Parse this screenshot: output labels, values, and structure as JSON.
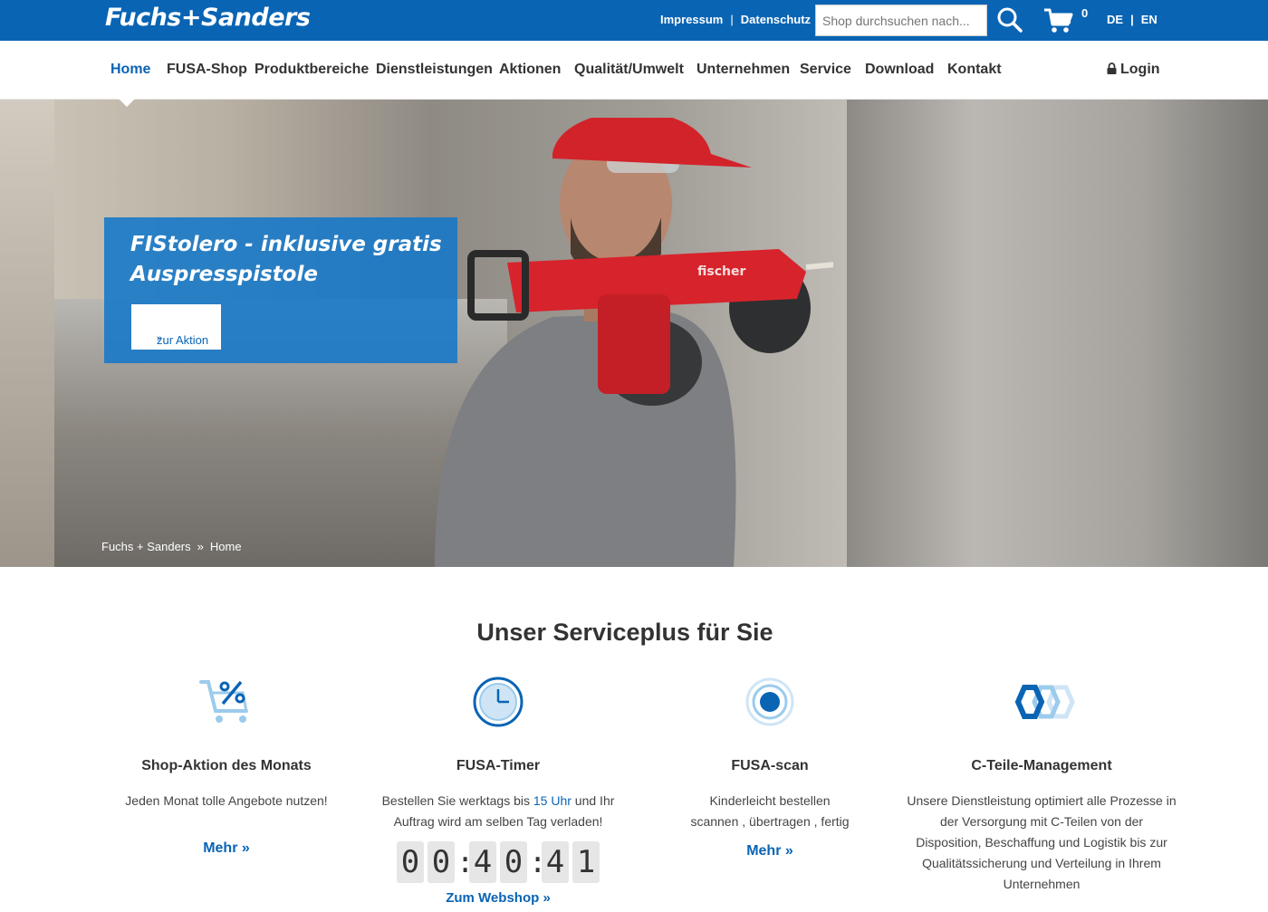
{
  "header": {
    "logo": "Fuchs+Sanders",
    "links": [
      "Impressum",
      "Datenschutz"
    ],
    "search_placeholder": "Shop durchsuchen nach...",
    "cart_count": "0",
    "languages": [
      "DE",
      "EN"
    ]
  },
  "nav": {
    "items": [
      "Home",
      "FUSA-Shop",
      "Produktbereiche",
      "Dienstleistungen",
      "Aktionen",
      "Qualität/Umwelt",
      "Unternehmen",
      "Service",
      "Download",
      "Kontakt"
    ],
    "active": "Home",
    "login_label": "Login"
  },
  "hero": {
    "title": "FIStolero - inklusive gratis Auspresspistole",
    "button_label": "zur Aktion",
    "button_arrow": "»",
    "breadcrumb": [
      "Fuchs + Sanders",
      "Home"
    ],
    "tool_brand": "fischer"
  },
  "services": {
    "title": "Unser Serviceplus für Sie",
    "items": [
      {
        "title": "Shop-Aktion des Monats",
        "text": "Jeden Monat tolle Angebote nutzen!",
        "link": "Mehr  »",
        "icon": "cart-percent-icon"
      },
      {
        "title": "FUSA-Timer",
        "text_pre": "Bestellen Sie werktags bis ",
        "text_hl": "15 Uhr",
        "text_post": " und Ihr Auftrag wird am selben Tag verladen!",
        "link": "Zum Webshop  »",
        "icon": "clock-icon"
      },
      {
        "title": "FUSA-scan",
        "text": "Kinderleicht bestellen scannen , übertragen , fertig",
        "link": "Mehr  »",
        "icon": "scan-target-icon"
      },
      {
        "title": "C-Teile-Management",
        "text": "Unsere Dienstleistung optimiert alle Prozesse in der Versorgung mit C-Teilen von der Disposition, Beschaffung und Logistik bis zur Qualitätssicherung und Verteilung in Ihrem Unternehmen",
        "link": "",
        "icon": "nuts-icon"
      }
    ],
    "timer": [
      "0",
      "0",
      "4",
      "0",
      "4",
      "1"
    ]
  },
  "colors": {
    "brand_blue": "#0a64b4",
    "promo_blue": "#1478c8",
    "icon_light_blue": "#9ccbec"
  }
}
